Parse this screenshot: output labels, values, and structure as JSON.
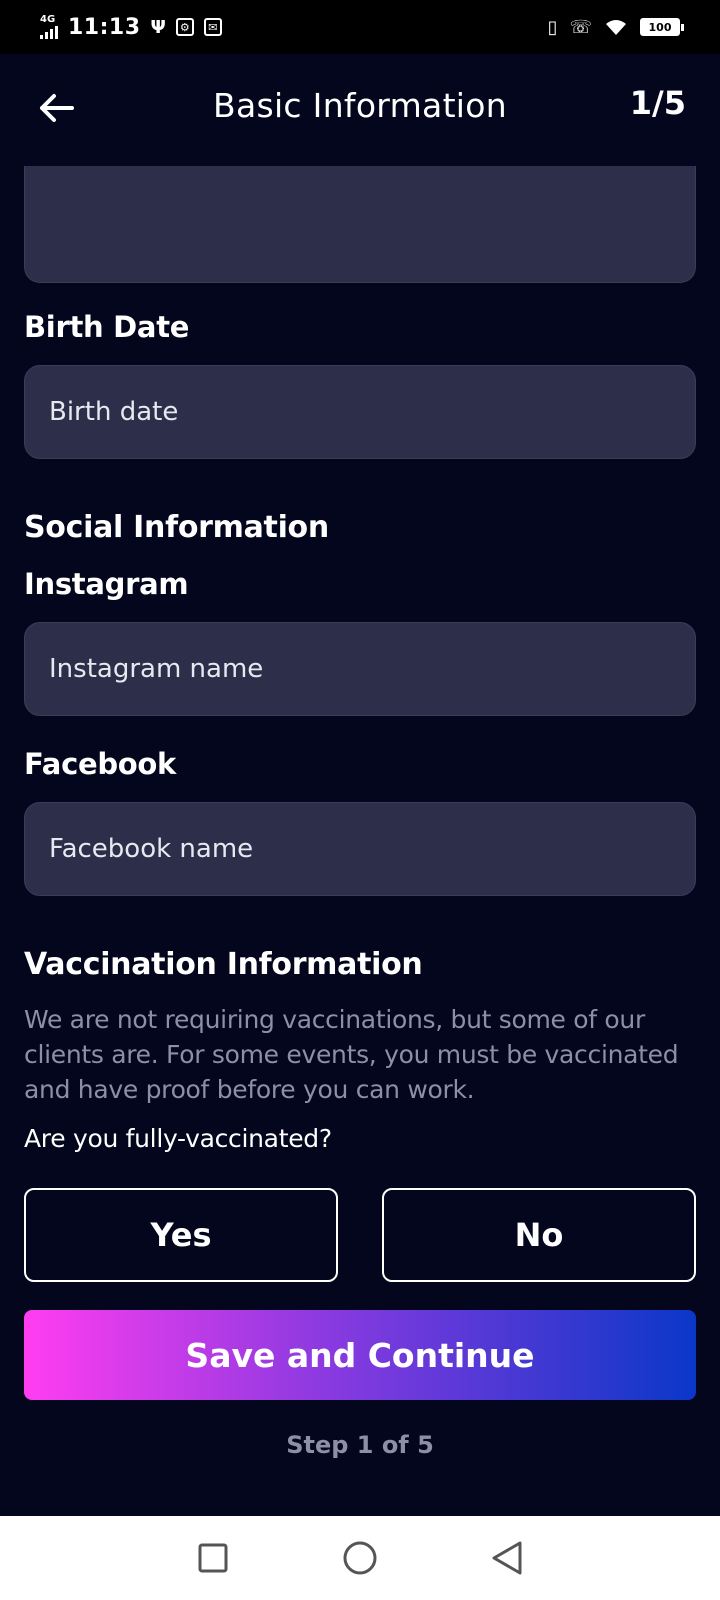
{
  "status": {
    "network": "4G",
    "time": "11:13",
    "battery": "100"
  },
  "header": {
    "title": "Basic Information",
    "step": "1/5"
  },
  "form": {
    "birth_date_label": "Birth Date",
    "birth_date_placeholder": "Birth date",
    "social_section": "Social Information",
    "instagram_label": "Instagram",
    "instagram_placeholder": "Instagram name",
    "facebook_label": "Facebook",
    "facebook_placeholder": "Facebook name",
    "vaccination_section": "Vaccination Information",
    "vaccination_description": "We are not requiring vaccinations, but some of our clients are. For some events, you must be vaccinated and have proof before you can work.",
    "vaccination_question": "Are you fully-vaccinated?",
    "yes_label": "Yes",
    "no_label": "No"
  },
  "footer": {
    "save_label": "Save and Continue",
    "step_text": "Step 1 of 5"
  },
  "colors": {
    "background": "#03061c",
    "field": "#2d2f4a",
    "muted_text": "#8c8fa8",
    "gradient_start": "#ff3df0",
    "gradient_end": "#0a37c8"
  },
  "icons": {
    "back": "arrow-left-icon",
    "nav_recent": "square-icon",
    "nav_home": "circle-icon",
    "nav_back": "triangle-back-icon"
  }
}
